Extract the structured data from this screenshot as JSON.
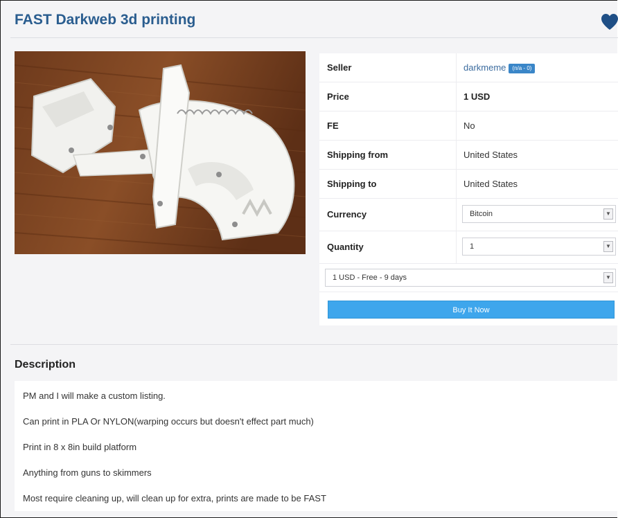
{
  "listing": {
    "title": "FAST Darkweb 3d printing"
  },
  "details": {
    "seller_label": "Seller",
    "seller_name": "darkmeme",
    "seller_badge": "(n/a - 0)",
    "price_label": "Price",
    "price_value": "1 USD",
    "fe_label": "FE",
    "fe_value": "No",
    "ship_from_label": "Shipping from",
    "ship_from_value": "United States",
    "ship_to_label": "Shipping to",
    "ship_to_value": "United States",
    "currency_label": "Currency",
    "currency_value": "Bitcoin",
    "quantity_label": "Quantity",
    "quantity_value": "1",
    "shipping_option": "1 USD - Free - 9 days",
    "buy_label": "Buy It Now"
  },
  "description": {
    "heading": "Description",
    "lines": [
      "PM and I will make a custom listing.",
      "Can print in PLA Or NYLON(warping occurs but doesn't effect part much)",
      "Print in 8 x 8in build platform",
      "Anything from guns to skimmers",
      "Most require cleaning up, will clean up for extra, prints are made to be FAST"
    ]
  },
  "icons": {
    "favorite": "heart-icon",
    "dropdown": "chevron-down-icon"
  },
  "colors": {
    "title": "#2a5d8f",
    "link": "#3c6c9f",
    "button": "#3ea6ec",
    "badge": "#3a86c8"
  }
}
